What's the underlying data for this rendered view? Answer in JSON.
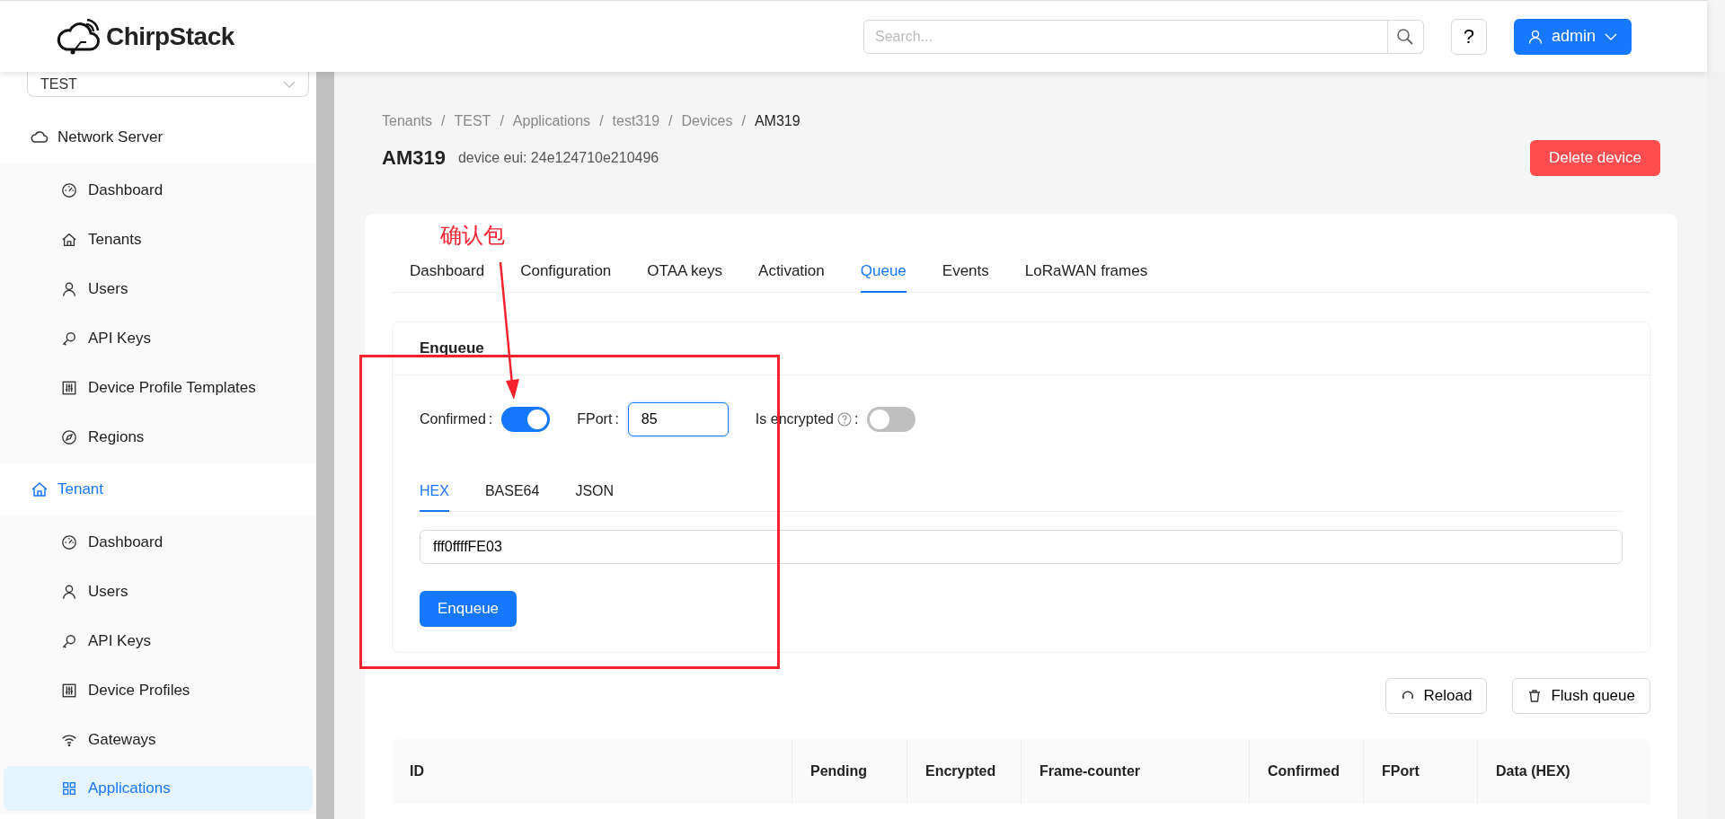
{
  "header": {
    "logo": "ChirpStack",
    "search": {
      "placeholder": "Search..."
    },
    "help": "?",
    "user": "admin"
  },
  "sidebar": {
    "tenant_select": "TEST",
    "sections": [
      {
        "label": "Network Server",
        "selected": false,
        "items": [
          {
            "label": "Dashboard",
            "selected": false
          },
          {
            "label": "Tenants",
            "selected": false
          },
          {
            "label": "Users",
            "selected": false
          },
          {
            "label": "API Keys",
            "selected": false
          },
          {
            "label": "Device Profile Templates",
            "selected": false
          },
          {
            "label": "Regions",
            "selected": false
          }
        ]
      },
      {
        "label": "Tenant",
        "selected": true,
        "items": [
          {
            "label": "Dashboard",
            "selected": false
          },
          {
            "label": "Users",
            "selected": false
          },
          {
            "label": "API Keys",
            "selected": false
          },
          {
            "label": "Device Profiles",
            "selected": false
          },
          {
            "label": "Gateways",
            "selected": false
          },
          {
            "label": "Applications",
            "selected": true
          }
        ]
      }
    ]
  },
  "breadcrumb": {
    "separator": "/",
    "items": [
      "Tenants",
      "TEST",
      "Applications",
      "test319",
      "Devices",
      "AM319"
    ]
  },
  "page": {
    "title": "AM319",
    "subtitle": "device eui: 24e124710e210496",
    "delete_button": "Delete device"
  },
  "tabs": [
    {
      "label": "Dashboard",
      "selected": false
    },
    {
      "label": "Configuration",
      "selected": false
    },
    {
      "label": "OTAA keys",
      "selected": false
    },
    {
      "label": "Activation",
      "selected": false
    },
    {
      "label": "Queue",
      "selected": true
    },
    {
      "label": "Events",
      "selected": false
    },
    {
      "label": "LoRaWAN frames",
      "selected": false
    }
  ],
  "enqueue": {
    "title": "Enqueue",
    "colon": ":",
    "confirmed": {
      "label": "Confirmed",
      "on": true
    },
    "fport": {
      "label": "FPort",
      "value": "85"
    },
    "encrypted": {
      "label": "Is encrypted",
      "on": false
    },
    "payload_tabs": [
      {
        "label": "HEX",
        "selected": true
      },
      {
        "label": "BASE64",
        "selected": false
      },
      {
        "label": "JSON",
        "selected": false
      }
    ],
    "payload": "fff0ffffFE03",
    "button": "Enqueue"
  },
  "actions": [
    {
      "label": "Reload",
      "kind": "reload"
    },
    {
      "label": "Flush queue",
      "kind": "delete"
    }
  ],
  "table": {
    "columns": [
      "ID",
      "Pending",
      "Encrypted",
      "Frame-counter",
      "Confirmed",
      "FPort",
      "Data (HEX)"
    ]
  },
  "annotation": {
    "text": "确认包"
  }
}
